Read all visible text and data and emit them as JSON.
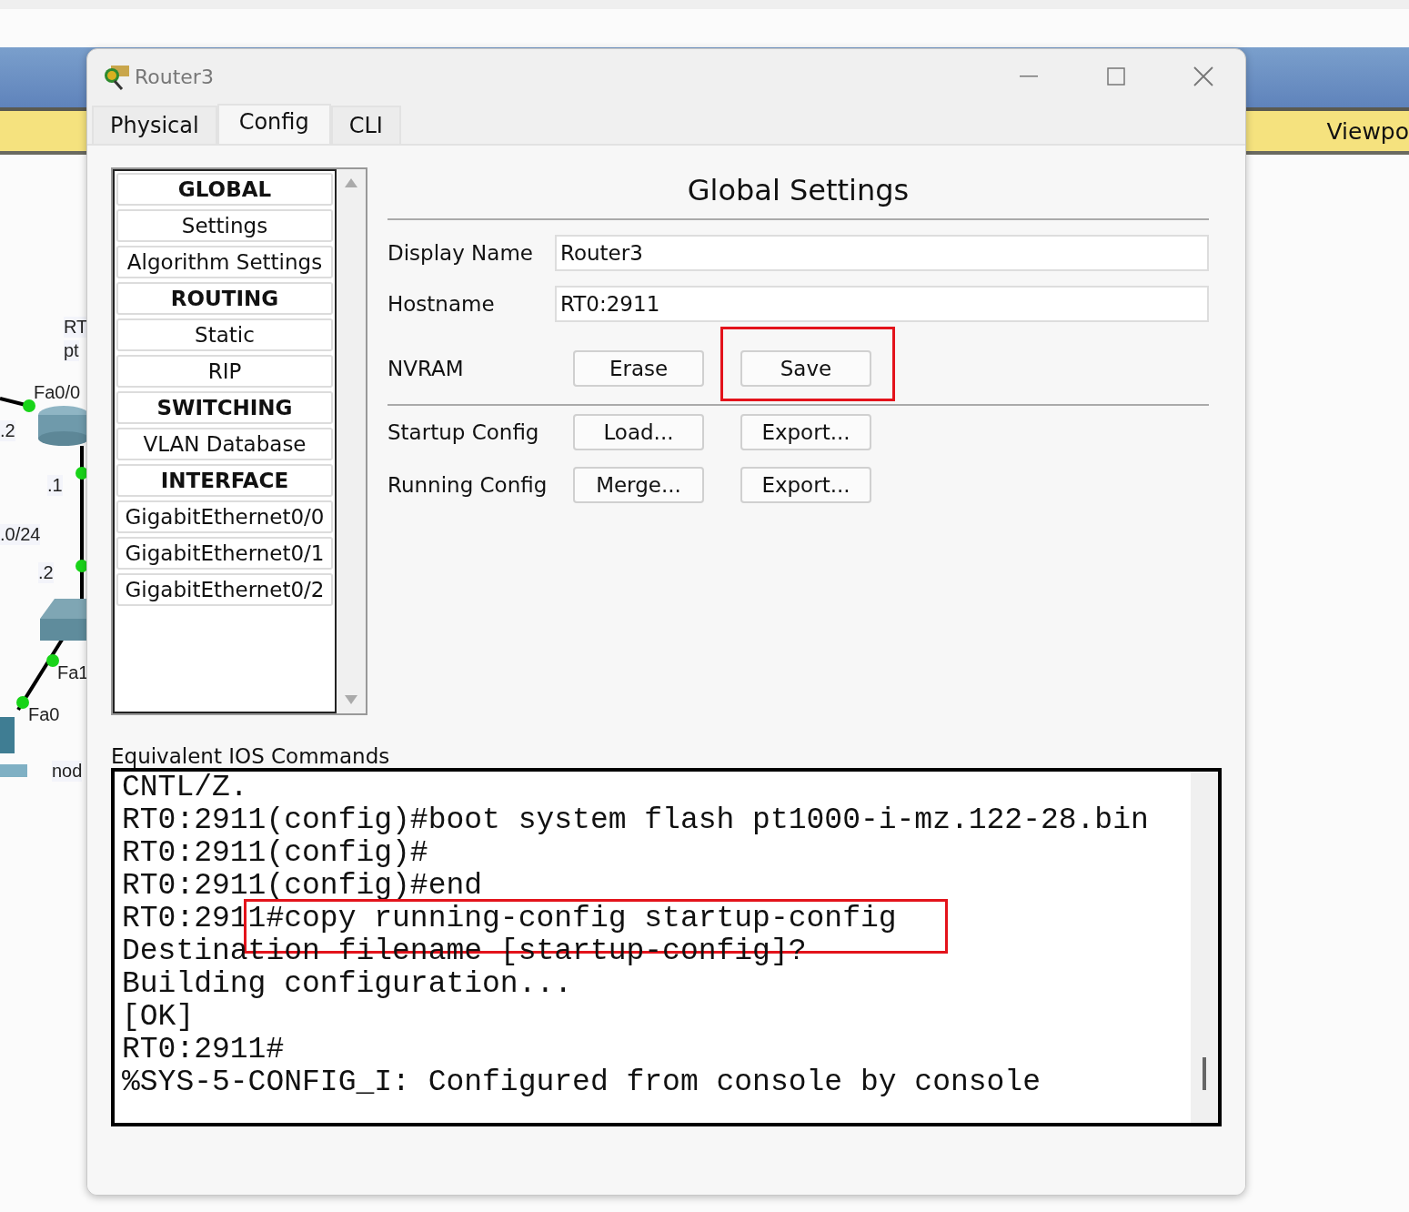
{
  "workspace": {
    "toolbar_label": "Viewpo",
    "labels": [
      {
        "text": "RT",
        "kind": "device"
      },
      {
        "text": "pt",
        "kind": "device"
      },
      {
        "text": "Fa0/0",
        "kind": "port"
      },
      {
        "text": ".2",
        "kind": "ip"
      },
      {
        "text": ".1",
        "kind": "ip"
      },
      {
        "text": ".0/24",
        "kind": "ip"
      },
      {
        "text": ".2",
        "kind": "ip"
      },
      {
        "text": "Fa1",
        "kind": "port"
      },
      {
        "text": "Fa0",
        "kind": "port"
      },
      {
        "text": "nod",
        "kind": "device"
      }
    ]
  },
  "window": {
    "title": "Router3"
  },
  "tabs": [
    {
      "label": "Physical",
      "selected": false
    },
    {
      "label": "Config",
      "selected": true
    },
    {
      "label": "CLI",
      "selected": false
    }
  ],
  "sidebar": {
    "items": [
      {
        "label": "GLOBAL",
        "kind": "header"
      },
      {
        "label": "Settings",
        "kind": "item"
      },
      {
        "label": "Algorithm Settings",
        "kind": "item"
      },
      {
        "label": "ROUTING",
        "kind": "header"
      },
      {
        "label": "Static",
        "kind": "item"
      },
      {
        "label": "RIP",
        "kind": "item"
      },
      {
        "label": "SWITCHING",
        "kind": "header"
      },
      {
        "label": "VLAN Database",
        "kind": "item"
      },
      {
        "label": "INTERFACE",
        "kind": "header"
      },
      {
        "label": "GigabitEthernet0/0",
        "kind": "item"
      },
      {
        "label": "GigabitEthernet0/1",
        "kind": "item"
      },
      {
        "label": "GigabitEthernet0/2",
        "kind": "item"
      }
    ]
  },
  "settings": {
    "title": "Global Settings",
    "fields": [
      {
        "label": "Display Name",
        "value": "Router3"
      },
      {
        "label": "Hostname",
        "value": "RT0:2911"
      }
    ],
    "nvram": {
      "label": "NVRAM",
      "buttons": [
        {
          "label": "Erase",
          "highlighted": false
        },
        {
          "label": "Save",
          "highlighted": true
        }
      ]
    },
    "config_rows": [
      {
        "label": "Startup Config",
        "buttons": [
          {
            "label": "Load...",
            "highlighted": false
          },
          {
            "label": "Export...",
            "highlighted": false
          }
        ]
      },
      {
        "label": "Running Config",
        "buttons": [
          {
            "label": "Merge...",
            "highlighted": false
          },
          {
            "label": "Export...",
            "highlighted": false
          }
        ]
      }
    ]
  },
  "commands": {
    "label": "Equivalent IOS Commands",
    "lines": [
      {
        "text": "CNTL/Z.",
        "highlighted": false
      },
      {
        "text": "RT0:2911(config)#boot system flash pt1000-i-mz.122-28.bin",
        "highlighted": false
      },
      {
        "text": "RT0:2911(config)#",
        "highlighted": false
      },
      {
        "text": "RT0:2911(config)#end",
        "highlighted": false
      },
      {
        "text": "RT0:2911#copy running-config startup-config",
        "highlighted": true
      },
      {
        "text": "Destination filename [startup-config]?",
        "highlighted": false
      },
      {
        "text": "Building configuration...",
        "highlighted": false
      },
      {
        "text": "[OK]",
        "highlighted": false
      },
      {
        "text": "RT0:2911#",
        "highlighted": false
      },
      {
        "text": "%SYS-5-CONFIG_I: Configured from console by console",
        "highlighted": false
      }
    ]
  }
}
